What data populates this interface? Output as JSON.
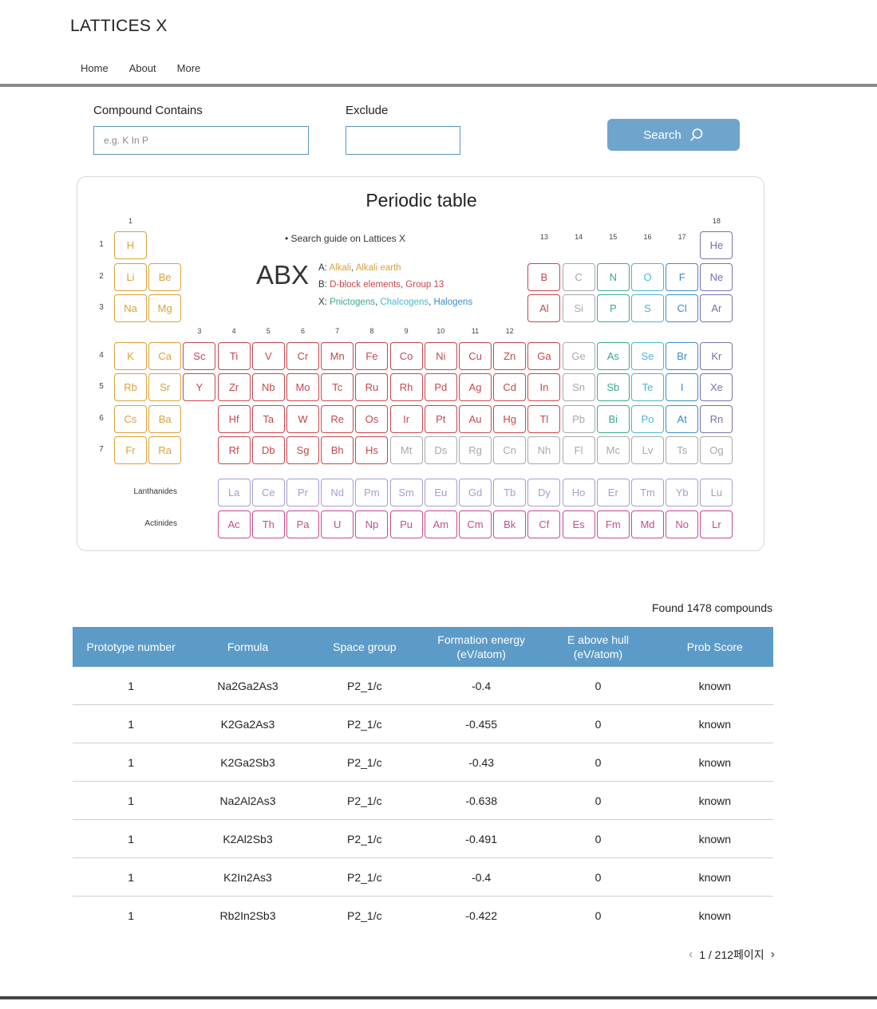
{
  "site": {
    "title": "LATTICES X"
  },
  "nav": {
    "items": [
      "Home",
      "About",
      "More"
    ]
  },
  "search": {
    "contains_label": "Compound Contains",
    "contains_placeholder": "e.g. K In P",
    "contains_value": "",
    "exclude_label": "Exclude",
    "exclude_value": "",
    "button_label": "Search"
  },
  "periodic_table": {
    "title": "Periodic table",
    "guide_title": "• Search guide on Lattices X",
    "abx": "ABX",
    "legend_a_prefix": "A: ",
    "legend_a": [
      {
        "text": "Alkali",
        "color": "#d9a23a"
      },
      {
        "text": ", ",
        "color": "#444"
      },
      {
        "text": "Alkali earth",
        "color": "#d9a23a"
      }
    ],
    "legend_b_prefix": "B: ",
    "legend_b": [
      {
        "text": "D-block elements",
        "color": "#c8464c"
      },
      {
        "text": ", ",
        "color": "#444"
      },
      {
        "text": "Group 13",
        "color": "#c8464c"
      }
    ],
    "legend_x_prefix": "X: ",
    "legend_x": [
      {
        "text": "Pnictogens",
        "color": "#3aa98f"
      },
      {
        "text": ", ",
        "color": "#444"
      },
      {
        "text": "Chalcogens",
        "color": "#4bb6cf"
      },
      {
        "text": ", ",
        "color": "#444"
      },
      {
        "text": "Halogens",
        "color": "#3a8cc8"
      }
    ],
    "lanthanides_label": "Lanthanides",
    "actinides_label": "Actinides",
    "group_numbers": [
      "1",
      "3",
      "4",
      "5",
      "6",
      "7",
      "8",
      "9",
      "10",
      "11",
      "12",
      "13",
      "14",
      "15",
      "16",
      "17",
      "18"
    ],
    "period_numbers": [
      "1",
      "2",
      "3",
      "4",
      "5",
      "6",
      "7"
    ],
    "colors": {
      "alkali": "#d9a23a",
      "dblock": "#c8464c",
      "metalloid": "#a8a8a8",
      "pnictogen": "#3aa98f",
      "chalcogen": "#4bb6cf",
      "halogen": "#3a8cc8",
      "noble": "#7a6fb0",
      "lanthanide": "#a89bd0",
      "actinide": "#c84a8e"
    },
    "elements": [
      {
        "s": "H",
        "g": 1,
        "p": 1,
        "c": "alkali"
      },
      {
        "s": "He",
        "g": 18,
        "p": 1,
        "c": "noble"
      },
      {
        "s": "Li",
        "g": 1,
        "p": 2,
        "c": "alkali"
      },
      {
        "s": "Be",
        "g": 2,
        "p": 2,
        "c": "alkali"
      },
      {
        "s": "B",
        "g": 13,
        "p": 2,
        "c": "dblock"
      },
      {
        "s": "C",
        "g": 14,
        "p": 2,
        "c": "metalloid"
      },
      {
        "s": "N",
        "g": 15,
        "p": 2,
        "c": "pnictogen"
      },
      {
        "s": "O",
        "g": 16,
        "p": 2,
        "c": "chalcogen"
      },
      {
        "s": "F",
        "g": 17,
        "p": 2,
        "c": "halogen"
      },
      {
        "s": "Ne",
        "g": 18,
        "p": 2,
        "c": "noble"
      },
      {
        "s": "Na",
        "g": 1,
        "p": 3,
        "c": "alkali"
      },
      {
        "s": "Mg",
        "g": 2,
        "p": 3,
        "c": "alkali"
      },
      {
        "s": "Al",
        "g": 13,
        "p": 3,
        "c": "dblock"
      },
      {
        "s": "Si",
        "g": 14,
        "p": 3,
        "c": "metalloid"
      },
      {
        "s": "P",
        "g": 15,
        "p": 3,
        "c": "pnictogen"
      },
      {
        "s": "S",
        "g": 16,
        "p": 3,
        "c": "chalcogen"
      },
      {
        "s": "Cl",
        "g": 17,
        "p": 3,
        "c": "halogen"
      },
      {
        "s": "Ar",
        "g": 18,
        "p": 3,
        "c": "noble"
      },
      {
        "s": "K",
        "g": 1,
        "p": 4,
        "c": "alkali"
      },
      {
        "s": "Ca",
        "g": 2,
        "p": 4,
        "c": "alkali"
      },
      {
        "s": "Sc",
        "g": 3,
        "p": 4,
        "c": "dblock"
      },
      {
        "s": "Ti",
        "g": 4,
        "p": 4,
        "c": "dblock"
      },
      {
        "s": "V",
        "g": 5,
        "p": 4,
        "c": "dblock"
      },
      {
        "s": "Cr",
        "g": 6,
        "p": 4,
        "c": "dblock"
      },
      {
        "s": "Mn",
        "g": 7,
        "p": 4,
        "c": "dblock"
      },
      {
        "s": "Fe",
        "g": 8,
        "p": 4,
        "c": "dblock"
      },
      {
        "s": "Co",
        "g": 9,
        "p": 4,
        "c": "dblock"
      },
      {
        "s": "Ni",
        "g": 10,
        "p": 4,
        "c": "dblock"
      },
      {
        "s": "Cu",
        "g": 11,
        "p": 4,
        "c": "dblock"
      },
      {
        "s": "Zn",
        "g": 12,
        "p": 4,
        "c": "dblock"
      },
      {
        "s": "Ga",
        "g": 13,
        "p": 4,
        "c": "dblock"
      },
      {
        "s": "Ge",
        "g": 14,
        "p": 4,
        "c": "metalloid"
      },
      {
        "s": "As",
        "g": 15,
        "p": 4,
        "c": "pnictogen"
      },
      {
        "s": "Se",
        "g": 16,
        "p": 4,
        "c": "chalcogen"
      },
      {
        "s": "Br",
        "g": 17,
        "p": 4,
        "c": "halogen"
      },
      {
        "s": "Kr",
        "g": 18,
        "p": 4,
        "c": "noble"
      },
      {
        "s": "Rb",
        "g": 1,
        "p": 5,
        "c": "alkali"
      },
      {
        "s": "Sr",
        "g": 2,
        "p": 5,
        "c": "alkali"
      },
      {
        "s": "Y",
        "g": 3,
        "p": 5,
        "c": "dblock"
      },
      {
        "s": "Zr",
        "g": 4,
        "p": 5,
        "c": "dblock"
      },
      {
        "s": "Nb",
        "g": 5,
        "p": 5,
        "c": "dblock"
      },
      {
        "s": "Mo",
        "g": 6,
        "p": 5,
        "c": "dblock"
      },
      {
        "s": "Tc",
        "g": 7,
        "p": 5,
        "c": "dblock"
      },
      {
        "s": "Ru",
        "g": 8,
        "p": 5,
        "c": "dblock"
      },
      {
        "s": "Rh",
        "g": 9,
        "p": 5,
        "c": "dblock"
      },
      {
        "s": "Pd",
        "g": 10,
        "p": 5,
        "c": "dblock"
      },
      {
        "s": "Ag",
        "g": 11,
        "p": 5,
        "c": "dblock"
      },
      {
        "s": "Cd",
        "g": 12,
        "p": 5,
        "c": "dblock"
      },
      {
        "s": "In",
        "g": 13,
        "p": 5,
        "c": "dblock"
      },
      {
        "s": "Sn",
        "g": 14,
        "p": 5,
        "c": "metalloid"
      },
      {
        "s": "Sb",
        "g": 15,
        "p": 5,
        "c": "pnictogen"
      },
      {
        "s": "Te",
        "g": 16,
        "p": 5,
        "c": "chalcogen"
      },
      {
        "s": "I",
        "g": 17,
        "p": 5,
        "c": "halogen"
      },
      {
        "s": "Xe",
        "g": 18,
        "p": 5,
        "c": "noble"
      },
      {
        "s": "Cs",
        "g": 1,
        "p": 6,
        "c": "alkali"
      },
      {
        "s": "Ba",
        "g": 2,
        "p": 6,
        "c": "alkali"
      },
      {
        "s": "Hf",
        "g": 4,
        "p": 6,
        "c": "dblock"
      },
      {
        "s": "Ta",
        "g": 5,
        "p": 6,
        "c": "dblock"
      },
      {
        "s": "W",
        "g": 6,
        "p": 6,
        "c": "dblock"
      },
      {
        "s": "Re",
        "g": 7,
        "p": 6,
        "c": "dblock"
      },
      {
        "s": "Os",
        "g": 8,
        "p": 6,
        "c": "dblock"
      },
      {
        "s": "Ir",
        "g": 9,
        "p": 6,
        "c": "dblock"
      },
      {
        "s": "Pt",
        "g": 10,
        "p": 6,
        "c": "dblock"
      },
      {
        "s": "Au",
        "g": 11,
        "p": 6,
        "c": "dblock"
      },
      {
        "s": "Hg",
        "g": 12,
        "p": 6,
        "c": "dblock"
      },
      {
        "s": "Tl",
        "g": 13,
        "p": 6,
        "c": "dblock"
      },
      {
        "s": "Pb",
        "g": 14,
        "p": 6,
        "c": "metalloid"
      },
      {
        "s": "Bi",
        "g": 15,
        "p": 6,
        "c": "pnictogen"
      },
      {
        "s": "Po",
        "g": 16,
        "p": 6,
        "c": "chalcogen"
      },
      {
        "s": "At",
        "g": 17,
        "p": 6,
        "c": "halogen"
      },
      {
        "s": "Rn",
        "g": 18,
        "p": 6,
        "c": "noble"
      },
      {
        "s": "Fr",
        "g": 1,
        "p": 7,
        "c": "alkali"
      },
      {
        "s": "Ra",
        "g": 2,
        "p": 7,
        "c": "alkali"
      },
      {
        "s": "Rf",
        "g": 4,
        "p": 7,
        "c": "dblock"
      },
      {
        "s": "Db",
        "g": 5,
        "p": 7,
        "c": "dblock"
      },
      {
        "s": "Sg",
        "g": 6,
        "p": 7,
        "c": "dblock"
      },
      {
        "s": "Bh",
        "g": 7,
        "p": 7,
        "c": "dblock"
      },
      {
        "s": "Hs",
        "g": 8,
        "p": 7,
        "c": "dblock"
      },
      {
        "s": "Mt",
        "g": 9,
        "p": 7,
        "c": "metalloid"
      },
      {
        "s": "Ds",
        "g": 10,
        "p": 7,
        "c": "metalloid"
      },
      {
        "s": "Rg",
        "g": 11,
        "p": 7,
        "c": "metalloid"
      },
      {
        "s": "Cn",
        "g": 12,
        "p": 7,
        "c": "metalloid"
      },
      {
        "s": "Nh",
        "g": 13,
        "p": 7,
        "c": "metalloid"
      },
      {
        "s": "Fl",
        "g": 14,
        "p": 7,
        "c": "metalloid"
      },
      {
        "s": "Mc",
        "g": 15,
        "p": 7,
        "c": "metalloid"
      },
      {
        "s": "Lv",
        "g": 16,
        "p": 7,
        "c": "metalloid"
      },
      {
        "s": "Ts",
        "g": 17,
        "p": 7,
        "c": "metalloid"
      },
      {
        "s": "Og",
        "g": 18,
        "p": 7,
        "c": "metalloid"
      }
    ],
    "lanthanides": [
      "La",
      "Ce",
      "Pr",
      "Nd",
      "Pm",
      "Sm",
      "Eu",
      "Gd",
      "Tb",
      "Dy",
      "Ho",
      "Er",
      "Tm",
      "Yb",
      "Lu"
    ],
    "actinides": [
      "Ac",
      "Th",
      "Pa",
      "U",
      "Np",
      "Pu",
      "Am",
      "Cm",
      "Bk",
      "Cf",
      "Es",
      "Fm",
      "Md",
      "No",
      "Lr"
    ]
  },
  "results": {
    "found_text": "Found 1478 compounds",
    "columns": [
      [
        "Prototype number"
      ],
      [
        "Formula"
      ],
      [
        "Space group"
      ],
      [
        "Formation energy",
        "(eV/atom)"
      ],
      [
        "E above hull",
        "(eV/atom)"
      ],
      [
        "Prob Score"
      ]
    ],
    "rows": [
      [
        "1",
        "Na2Ga2As3",
        "P2_1/c",
        "-0.4",
        "0",
        "known"
      ],
      [
        "1",
        "K2Ga2As3",
        "P2_1/c",
        "-0.455",
        "0",
        "known"
      ],
      [
        "1",
        "K2Ga2Sb3",
        "P2_1/c",
        "-0.43",
        "0",
        "known"
      ],
      [
        "1",
        "Na2Al2As3",
        "P2_1/c",
        "-0.638",
        "0",
        "known"
      ],
      [
        "1",
        "K2Al2Sb3",
        "P2_1/c",
        "-0.491",
        "0",
        "known"
      ],
      [
        "1",
        "K2In2As3",
        "P2_1/c",
        "-0.4",
        "0",
        "known"
      ],
      [
        "1",
        "Rb2In2Sb3",
        "P2_1/c",
        "-0.422",
        "0",
        "known"
      ]
    ]
  },
  "pagination": {
    "text": "1 / 212페이지"
  }
}
